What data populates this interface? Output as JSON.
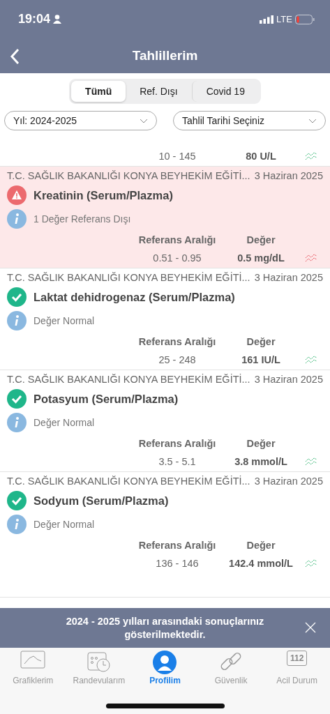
{
  "status_bar": {
    "time": "19:04",
    "network": "LTE"
  },
  "header": {
    "title": "Tahlillerim"
  },
  "tabs": [
    {
      "label": "Tümü",
      "selected": true
    },
    {
      "label": "Ref. Dışı",
      "selected": false
    },
    {
      "label": "Covid 19",
      "selected": false
    }
  ],
  "filters": [
    {
      "value": "Yıl: 2024-2025"
    },
    {
      "value": "Tahlil Tarihi Seçiniz"
    }
  ],
  "partial_top": {
    "range": "10 - 145",
    "value": "80 U/L",
    "out_of_range": false
  },
  "results": [
    {
      "institution": "T.C. SAĞLIK BAKANLIĞI KONYA BEYHEKİM EĞİTİ...",
      "date": "3 Haziran 2025",
      "out_of_range": true,
      "test": "Kreatinin (Serum/Plazma)",
      "note": "1 Değer Referans Dışı",
      "range_label": "Referans Aralığı",
      "value_label": "Değer",
      "range": "0.51 - 0.95",
      "value": "0.5 mg/dL"
    },
    {
      "institution": "T.C. SAĞLIK BAKANLIĞI KONYA BEYHEKİM EĞİTİ...",
      "date": "3 Haziran 2025",
      "out_of_range": false,
      "test": "Laktat dehidrogenaz (Serum/Plazma)",
      "note": "Değer Normal",
      "range_label": "Referans Aralığı",
      "value_label": "Değer",
      "range": "25 - 248",
      "value": "161 IU/L"
    },
    {
      "institution": "T.C. SAĞLIK BAKANLIĞI KONYA BEYHEKİM EĞİTİ...",
      "date": "3 Haziran 2025",
      "out_of_range": false,
      "test": "Potasyum (Serum/Plazma)",
      "note": "Değer Normal",
      "range_label": "Referans Aralığı",
      "value_label": "Değer",
      "range": "3.5 - 5.1",
      "value": "3.8 mmol/L"
    },
    {
      "institution": "T.C. SAĞLIK BAKANLIĞI KONYA BEYHEKİM EĞİTİ...",
      "date": "3 Haziran 2025",
      "out_of_range": false,
      "test": "Sodyum (Serum/Plazma)",
      "note": "Değer Normal",
      "range_label": "Referans Aralığı",
      "value_label": "Değer",
      "range": "136 - 146",
      "value": "142.4 mmol/L"
    }
  ],
  "banner": {
    "message": "2024 - 2025 yılları arasındaki sonuçlarınız gösterilmektedir."
  },
  "nav": [
    {
      "kind": "chart",
      "label": "Grafiklerim",
      "selected": false
    },
    {
      "kind": "calendar",
      "label": "Randevularım",
      "selected": false
    },
    {
      "kind": "profile",
      "label": "Profilim",
      "selected": true
    },
    {
      "kind": "link",
      "label": "Güvenlik",
      "selected": false
    },
    {
      "kind": "emergency",
      "label": "Acil Durum",
      "badge": "112",
      "selected": false
    }
  ]
}
